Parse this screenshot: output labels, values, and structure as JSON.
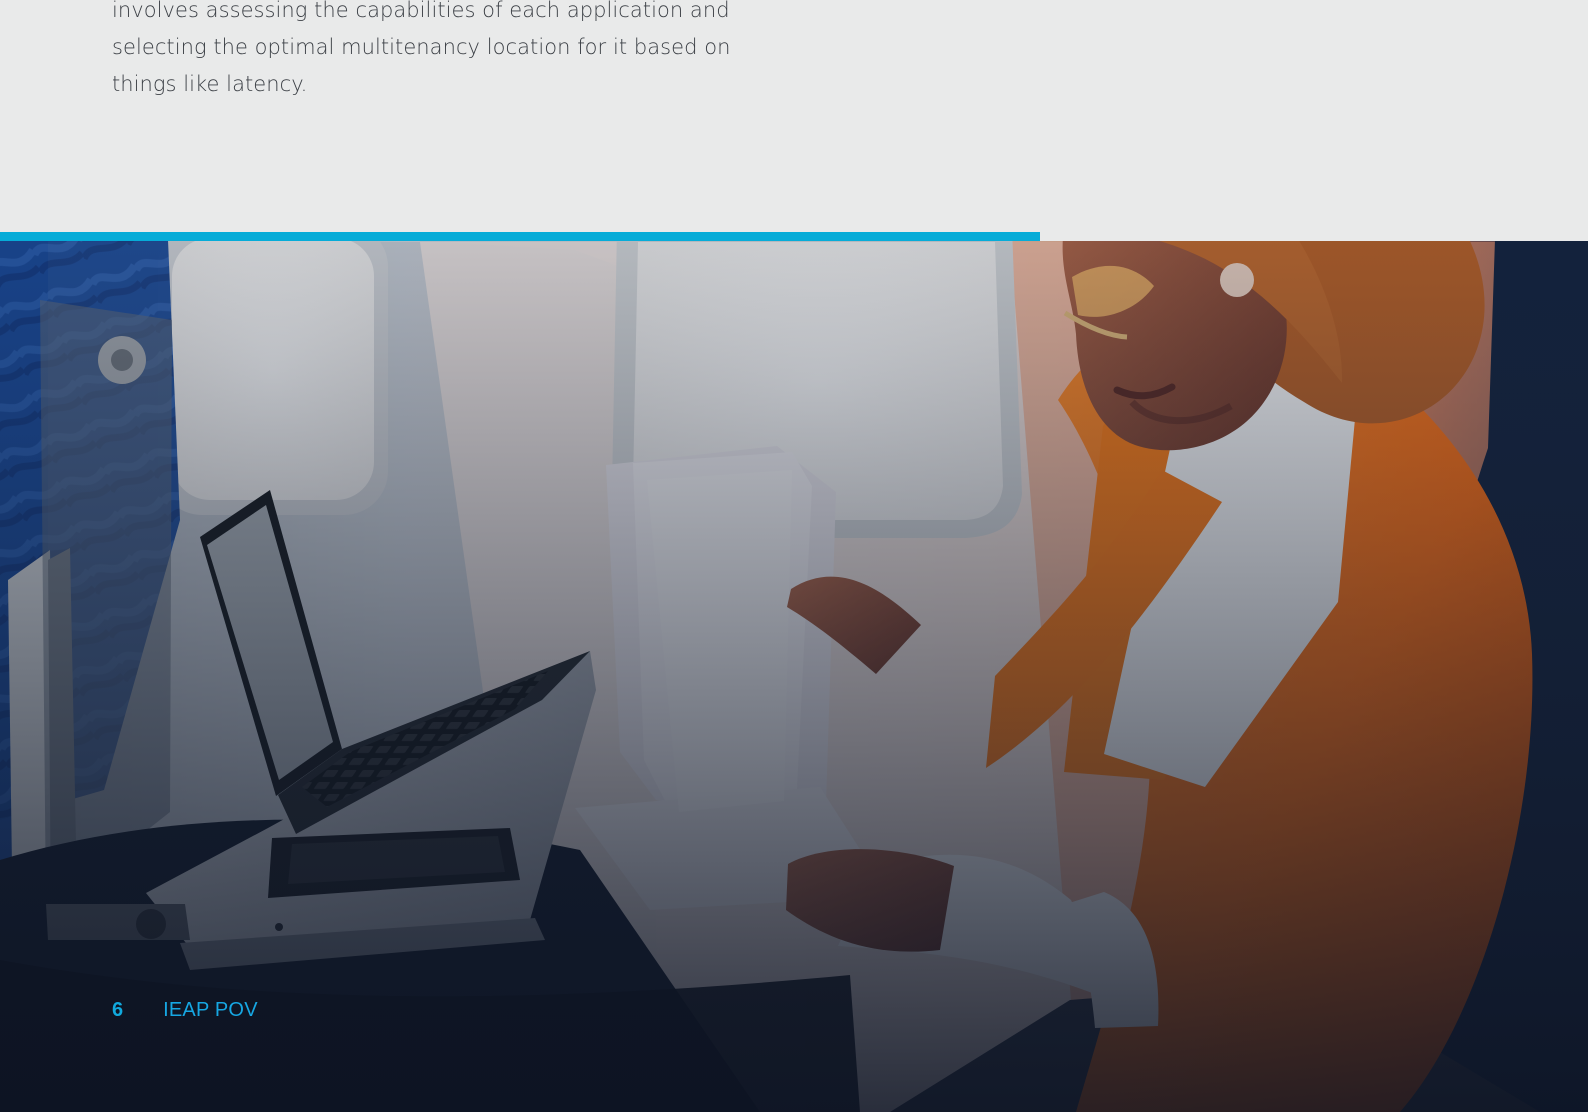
{
  "document": {
    "intro_text": "involves assessing the capabilities of each application and selecting the optimal multitenancy location for it based on things like latency."
  },
  "footer": {
    "page_number": "6",
    "label": "IEAP POV"
  },
  "colors": {
    "accent": "#06acd8",
    "footer_blue": "#16a7e3"
  }
}
